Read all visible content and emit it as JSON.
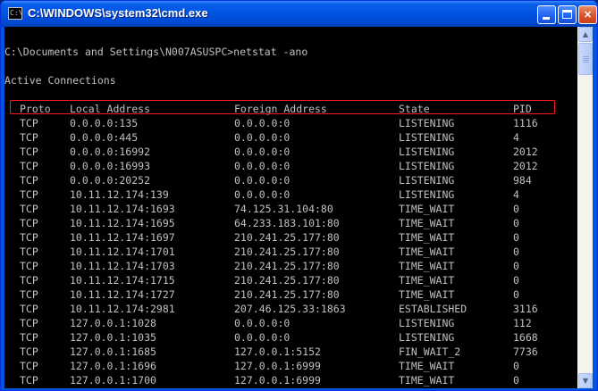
{
  "window": {
    "title": "C:\\WINDOWS\\system32\\cmd.exe",
    "icon_label": "C:\\",
    "controls": {
      "minimize": "minimize",
      "maximize": "maximize",
      "close": "×"
    }
  },
  "console": {
    "prompt_line": "C:\\Documents and Settings\\N007ASUSPC>netstat -ano",
    "section_title": "Active Connections",
    "columns": [
      "Proto",
      "Local Address",
      "Foreign Address",
      "State",
      "PID"
    ],
    "rows": [
      [
        "TCP",
        "0.0.0.0:135",
        "0.0.0.0:0",
        "LISTENING",
        "1116"
      ],
      [
        "TCP",
        "0.0.0.0:445",
        "0.0.0.0:0",
        "LISTENING",
        "4"
      ],
      [
        "TCP",
        "0.0.0.0:16992",
        "0.0.0.0:0",
        "LISTENING",
        "2012"
      ],
      [
        "TCP",
        "0.0.0.0:16993",
        "0.0.0.0:0",
        "LISTENING",
        "2012"
      ],
      [
        "TCP",
        "0.0.0.0:20252",
        "0.0.0.0:0",
        "LISTENING",
        "984"
      ],
      [
        "TCP",
        "10.11.12.174:139",
        "0.0.0.0:0",
        "LISTENING",
        "4"
      ],
      [
        "TCP",
        "10.11.12.174:1693",
        "74.125.31.104:80",
        "TIME_WAIT",
        "0"
      ],
      [
        "TCP",
        "10.11.12.174:1695",
        "64.233.183.101:80",
        "TIME_WAIT",
        "0"
      ],
      [
        "TCP",
        "10.11.12.174:1697",
        "210.241.25.177:80",
        "TIME_WAIT",
        "0"
      ],
      [
        "TCP",
        "10.11.12.174:1701",
        "210.241.25.177:80",
        "TIME_WAIT",
        "0"
      ],
      [
        "TCP",
        "10.11.12.174:1703",
        "210.241.25.177:80",
        "TIME_WAIT",
        "0"
      ],
      [
        "TCP",
        "10.11.12.174:1715",
        "210.241.25.177:80",
        "TIME_WAIT",
        "0"
      ],
      [
        "TCP",
        "10.11.12.174:1727",
        "210.241.25.177:80",
        "TIME_WAIT",
        "0"
      ],
      [
        "TCP",
        "10.11.12.174:2981",
        "207.46.125.33:1863",
        "ESTABLISHED",
        "3116"
      ],
      [
        "TCP",
        "127.0.0.1:1028",
        "0.0.0.0:0",
        "LISTENING",
        "112"
      ],
      [
        "TCP",
        "127.0.0.1:1035",
        "0.0.0.0:0",
        "LISTENING",
        "1668"
      ],
      [
        "TCP",
        "127.0.0.1:1685",
        "127.0.0.1:5152",
        "FIN_WAIT_2",
        "7736"
      ],
      [
        "TCP",
        "127.0.0.1:1696",
        "127.0.0.1:6999",
        "TIME_WAIT",
        "0"
      ],
      [
        "TCP",
        "127.0.0.1:1700",
        "127.0.0.1:6999",
        "TIME_WAIT",
        "0"
      ]
    ]
  },
  "scrollbar": {
    "up_arrow": "▲",
    "down_arrow": "▼"
  },
  "colors": {
    "titlebar": "#0054e3",
    "console_bg": "#000000",
    "console_text": "#c0c0c0",
    "highlight_border": "#ff1a1a"
  }
}
